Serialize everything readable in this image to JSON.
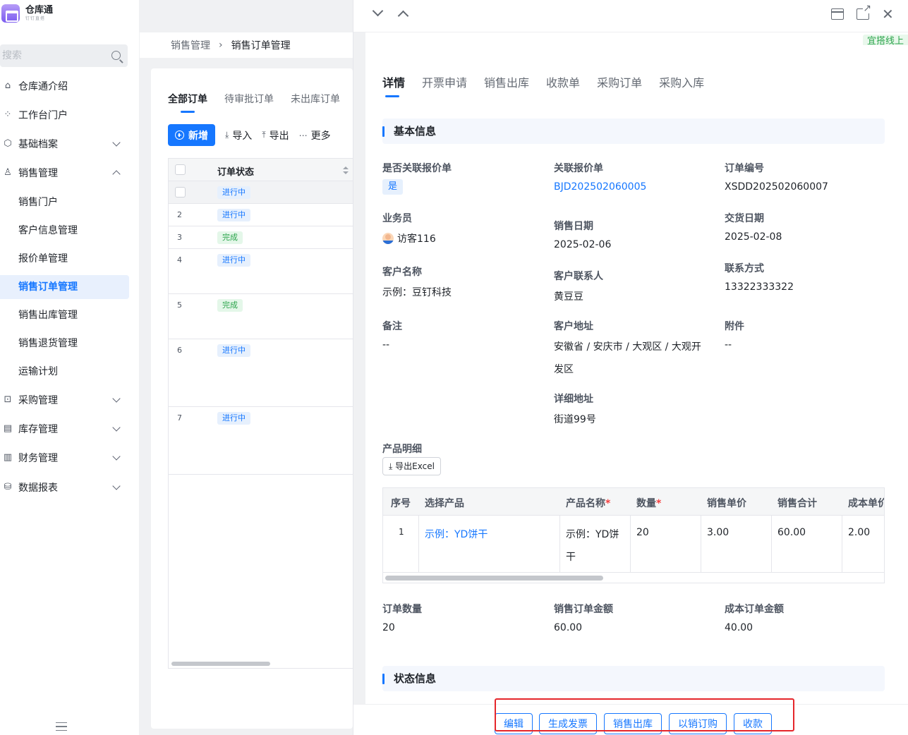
{
  "app": {
    "name": "仓库通",
    "subtitle": "钉钉直搭"
  },
  "sidebar": {
    "search_placeholder": "搜索",
    "items": [
      {
        "label": "仓库通介绍",
        "icon": "home-icon"
      },
      {
        "label": "工作台门户",
        "icon": "grid-icon"
      },
      {
        "label": "基础档案",
        "icon": "cube-icon",
        "expandable": true
      },
      {
        "label": "销售管理",
        "icon": "user-icon",
        "expanded": true
      },
      {
        "label": "销售门户"
      },
      {
        "label": "客户信息管理"
      },
      {
        "label": "报价单管理"
      },
      {
        "label": "销售订单管理",
        "active": true
      },
      {
        "label": "销售出库管理"
      },
      {
        "label": "销售退货管理"
      },
      {
        "label": "运输计划",
        "expandable": true
      },
      {
        "label": "采购管理",
        "icon": "bag-icon",
        "expandable": true
      },
      {
        "label": "库存管理",
        "icon": "warehouse-icon",
        "expandable": true
      },
      {
        "label": "财务管理",
        "icon": "finance-icon",
        "expandable": true
      },
      {
        "label": "数据报表",
        "icon": "database-icon",
        "expandable": true
      }
    ]
  },
  "breadcrumb": {
    "parent": "销售管理",
    "current": "销售订单管理"
  },
  "list": {
    "tabs": [
      "全部订单",
      "待审批订单",
      "未出库订单"
    ],
    "toolbar": {
      "new": "新增",
      "import": "导入",
      "export": "导出",
      "more": "更多"
    },
    "column_header": "订单状态",
    "rows": [
      {
        "index": "",
        "status": "进行中",
        "kind": "ip"
      },
      {
        "index": "2",
        "status": "进行中",
        "kind": "ip"
      },
      {
        "index": "3",
        "status": "完成",
        "kind": "done"
      },
      {
        "index": "4",
        "status": "进行中",
        "kind": "ip"
      },
      {
        "index": "5",
        "status": "完成",
        "kind": "done"
      },
      {
        "index": "6",
        "status": "进行中",
        "kind": "ip"
      },
      {
        "index": "7",
        "status": "进行中",
        "kind": "ip"
      }
    ]
  },
  "detail": {
    "top_badge": "宜搭线上",
    "tabs": [
      "详情",
      "开票申请",
      "销售出库",
      "收款单",
      "采购订单",
      "采购入库"
    ],
    "basic_section": "基本信息",
    "fields": {
      "link_quote_label": "是否关联报价单",
      "link_quote_value": "是",
      "quote_no_label": "关联报价单",
      "quote_no_value": "BJD202502060005",
      "order_no_label": "订单编号",
      "order_no_value": "XSDD202502060007",
      "salesman_label": "业务员",
      "salesman_value": "访客116",
      "sale_date_label": "销售日期",
      "sale_date_value": "2025-02-06",
      "delivery_date_label": "交货日期",
      "delivery_date_value": "2025-02-08",
      "customer_label": "客户名称",
      "customer_value": "示例：豆钉科技",
      "contact_label": "客户联系人",
      "contact_value": "黄豆豆",
      "phone_label": "联系方式",
      "phone_value": "13322333322",
      "remark_label": "备注",
      "remark_value": "--",
      "address_label": "客户地址",
      "address_value_line1": "安徽省 / 安庆市 / 大观区 / 大观开",
      "address_value_line2": "发区",
      "attachment_label": "附件",
      "attachment_value": "--",
      "detail_address_label": "详细地址",
      "detail_address_value": "街道99号"
    },
    "product_section": "产品明细",
    "export_excel": "导出Excel",
    "product_table": {
      "headers": {
        "seq": "序号",
        "product": "选择产品",
        "name": "产品名称",
        "qty": "数量",
        "price": "销售单价",
        "total": "销售合计",
        "cost": "成本单价"
      },
      "row": {
        "seq": "1",
        "product": "示例：YD饼干",
        "name_line1": "示例：YD饼",
        "name_line2": "干",
        "qty": "20",
        "price": "3.00",
        "total": "60.00",
        "cost": "2.00"
      }
    },
    "summary": {
      "qty_label": "订单数量",
      "qty_value": "20",
      "amount_label": "销售订单金额",
      "amount_value": "60.00",
      "cost_label": "成本订单金额",
      "cost_value": "40.00"
    },
    "status_section": "状态信息",
    "actions": [
      "编辑",
      "生成发票",
      "销售出库",
      "以销订购",
      "收款"
    ]
  },
  "colors": {
    "accent": "#1677ff",
    "highlight": "#e5262b",
    "done_green": "#2ba44b"
  }
}
